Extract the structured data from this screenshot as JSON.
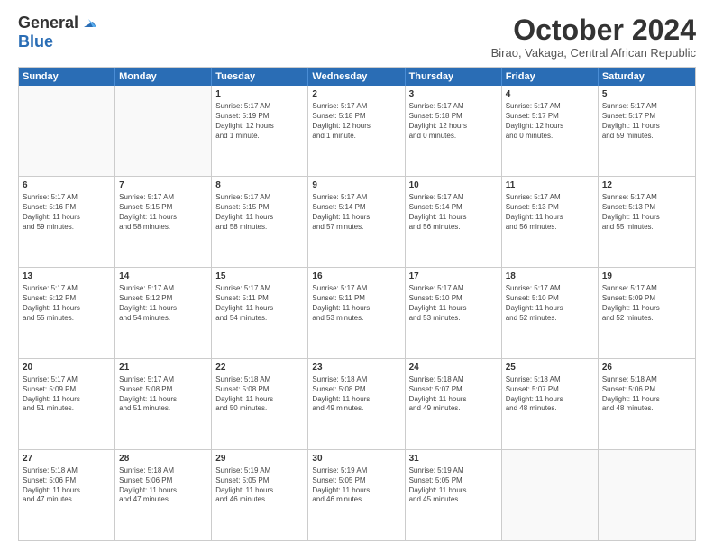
{
  "header": {
    "logo_general": "General",
    "logo_blue": "Blue",
    "month": "October 2024",
    "location": "Birao, Vakaga, Central African Republic"
  },
  "days": [
    "Sunday",
    "Monday",
    "Tuesday",
    "Wednesday",
    "Thursday",
    "Friday",
    "Saturday"
  ],
  "rows": [
    [
      {
        "day": "",
        "text": ""
      },
      {
        "day": "",
        "text": ""
      },
      {
        "day": "1",
        "text": "Sunrise: 5:17 AM\nSunset: 5:19 PM\nDaylight: 12 hours\nand 1 minute."
      },
      {
        "day": "2",
        "text": "Sunrise: 5:17 AM\nSunset: 5:18 PM\nDaylight: 12 hours\nand 1 minute."
      },
      {
        "day": "3",
        "text": "Sunrise: 5:17 AM\nSunset: 5:18 PM\nDaylight: 12 hours\nand 0 minutes."
      },
      {
        "day": "4",
        "text": "Sunrise: 5:17 AM\nSunset: 5:17 PM\nDaylight: 12 hours\nand 0 minutes."
      },
      {
        "day": "5",
        "text": "Sunrise: 5:17 AM\nSunset: 5:17 PM\nDaylight: 11 hours\nand 59 minutes."
      }
    ],
    [
      {
        "day": "6",
        "text": "Sunrise: 5:17 AM\nSunset: 5:16 PM\nDaylight: 11 hours\nand 59 minutes."
      },
      {
        "day": "7",
        "text": "Sunrise: 5:17 AM\nSunset: 5:15 PM\nDaylight: 11 hours\nand 58 minutes."
      },
      {
        "day": "8",
        "text": "Sunrise: 5:17 AM\nSunset: 5:15 PM\nDaylight: 11 hours\nand 58 minutes."
      },
      {
        "day": "9",
        "text": "Sunrise: 5:17 AM\nSunset: 5:14 PM\nDaylight: 11 hours\nand 57 minutes."
      },
      {
        "day": "10",
        "text": "Sunrise: 5:17 AM\nSunset: 5:14 PM\nDaylight: 11 hours\nand 56 minutes."
      },
      {
        "day": "11",
        "text": "Sunrise: 5:17 AM\nSunset: 5:13 PM\nDaylight: 11 hours\nand 56 minutes."
      },
      {
        "day": "12",
        "text": "Sunrise: 5:17 AM\nSunset: 5:13 PM\nDaylight: 11 hours\nand 55 minutes."
      }
    ],
    [
      {
        "day": "13",
        "text": "Sunrise: 5:17 AM\nSunset: 5:12 PM\nDaylight: 11 hours\nand 55 minutes."
      },
      {
        "day": "14",
        "text": "Sunrise: 5:17 AM\nSunset: 5:12 PM\nDaylight: 11 hours\nand 54 minutes."
      },
      {
        "day": "15",
        "text": "Sunrise: 5:17 AM\nSunset: 5:11 PM\nDaylight: 11 hours\nand 54 minutes."
      },
      {
        "day": "16",
        "text": "Sunrise: 5:17 AM\nSunset: 5:11 PM\nDaylight: 11 hours\nand 53 minutes."
      },
      {
        "day": "17",
        "text": "Sunrise: 5:17 AM\nSunset: 5:10 PM\nDaylight: 11 hours\nand 53 minutes."
      },
      {
        "day": "18",
        "text": "Sunrise: 5:17 AM\nSunset: 5:10 PM\nDaylight: 11 hours\nand 52 minutes."
      },
      {
        "day": "19",
        "text": "Sunrise: 5:17 AM\nSunset: 5:09 PM\nDaylight: 11 hours\nand 52 minutes."
      }
    ],
    [
      {
        "day": "20",
        "text": "Sunrise: 5:17 AM\nSunset: 5:09 PM\nDaylight: 11 hours\nand 51 minutes."
      },
      {
        "day": "21",
        "text": "Sunrise: 5:17 AM\nSunset: 5:08 PM\nDaylight: 11 hours\nand 51 minutes."
      },
      {
        "day": "22",
        "text": "Sunrise: 5:18 AM\nSunset: 5:08 PM\nDaylight: 11 hours\nand 50 minutes."
      },
      {
        "day": "23",
        "text": "Sunrise: 5:18 AM\nSunset: 5:08 PM\nDaylight: 11 hours\nand 49 minutes."
      },
      {
        "day": "24",
        "text": "Sunrise: 5:18 AM\nSunset: 5:07 PM\nDaylight: 11 hours\nand 49 minutes."
      },
      {
        "day": "25",
        "text": "Sunrise: 5:18 AM\nSunset: 5:07 PM\nDaylight: 11 hours\nand 48 minutes."
      },
      {
        "day": "26",
        "text": "Sunrise: 5:18 AM\nSunset: 5:06 PM\nDaylight: 11 hours\nand 48 minutes."
      }
    ],
    [
      {
        "day": "27",
        "text": "Sunrise: 5:18 AM\nSunset: 5:06 PM\nDaylight: 11 hours\nand 47 minutes."
      },
      {
        "day": "28",
        "text": "Sunrise: 5:18 AM\nSunset: 5:06 PM\nDaylight: 11 hours\nand 47 minutes."
      },
      {
        "day": "29",
        "text": "Sunrise: 5:19 AM\nSunset: 5:05 PM\nDaylight: 11 hours\nand 46 minutes."
      },
      {
        "day": "30",
        "text": "Sunrise: 5:19 AM\nSunset: 5:05 PM\nDaylight: 11 hours\nand 46 minutes."
      },
      {
        "day": "31",
        "text": "Sunrise: 5:19 AM\nSunset: 5:05 PM\nDaylight: 11 hours\nand 45 minutes."
      },
      {
        "day": "",
        "text": ""
      },
      {
        "day": "",
        "text": ""
      }
    ]
  ]
}
